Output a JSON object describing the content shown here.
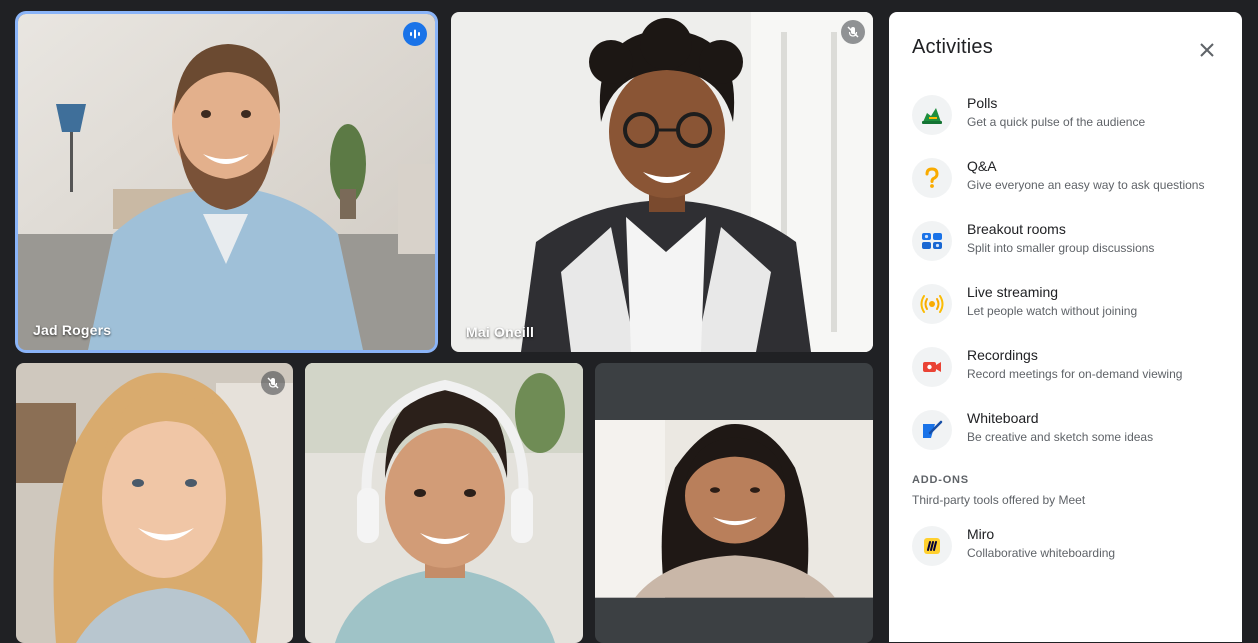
{
  "participants": [
    {
      "name": "Jad Rogers",
      "mic": "speaking-icon"
    },
    {
      "name": "Mai Oneill",
      "mic": "mic-off-icon"
    },
    {
      "name": "",
      "mic": "mic-off-icon"
    },
    {
      "name": "",
      "mic": ""
    },
    {
      "name": "",
      "mic": ""
    }
  ],
  "panel": {
    "title": "Activities",
    "close_icon": "close-icon",
    "activities": [
      {
        "title": "Polls",
        "desc": "Get a quick pulse of the audience",
        "icon": "polls-icon"
      },
      {
        "title": "Q&A",
        "desc": "Give everyone an easy way to ask questions",
        "icon": "question-icon"
      },
      {
        "title": "Breakout rooms",
        "desc": "Split into smaller group discussions",
        "icon": "breakout-rooms-icon"
      },
      {
        "title": "Live streaming",
        "desc": "Let people watch without joining",
        "icon": "live-streaming-icon"
      },
      {
        "title": "Recordings",
        "desc": "Record meetings for on-demand viewing",
        "icon": "recordings-icon"
      },
      {
        "title": "Whiteboard",
        "desc": "Be creative and sketch some ideas",
        "icon": "whiteboard-icon"
      }
    ],
    "addons": {
      "heading": "ADD-ONS",
      "subtitle": "Third-party tools offered by Meet",
      "items": [
        {
          "title": "Miro",
          "desc": "Collaborative whiteboarding",
          "icon": "miro-icon"
        }
      ]
    }
  },
  "colors": {
    "background": "#202124",
    "active_speaker_border": "#8ab4f8",
    "speaking_badge": "#1a73e8",
    "panel_bg": "#ffffff"
  }
}
